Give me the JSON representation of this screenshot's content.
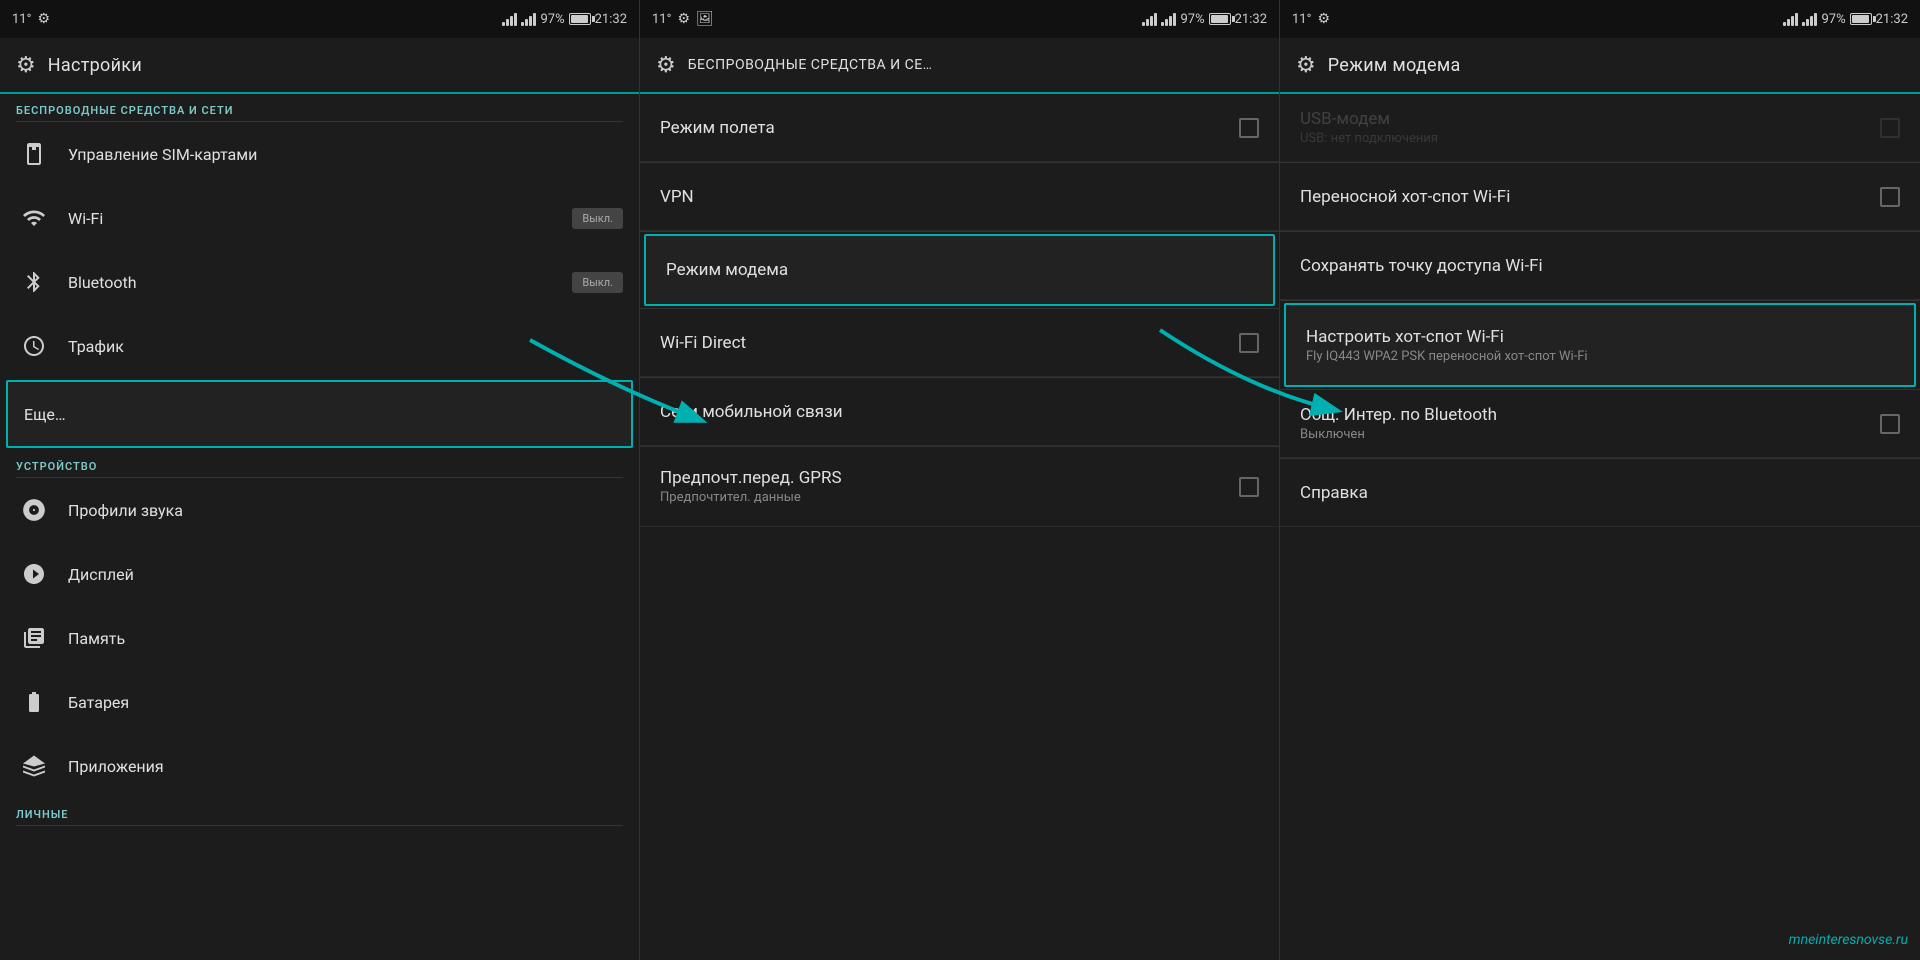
{
  "panel1": {
    "status": {
      "temp": "11°",
      "battery_pct": "97%",
      "time": "21:32"
    },
    "title": "Настройки",
    "section1": "БЕСПРОВОДНЫЕ СРЕДСТВА И СЕТИ",
    "items1": [
      {
        "icon": "sim",
        "label": "Управление SIM-картами",
        "toggle": null
      },
      {
        "icon": "wifi",
        "label": "Wi-Fi",
        "toggle": "Выкл."
      },
      {
        "icon": "bt",
        "label": "Bluetooth",
        "toggle": "Выкл."
      },
      {
        "icon": "traffic",
        "label": "Трафик",
        "toggle": null
      },
      {
        "icon": "more",
        "label": "Еще…",
        "toggle": null,
        "highlighted": true
      }
    ],
    "section2": "УСТРОЙСТВО",
    "items2": [
      {
        "icon": "sound",
        "label": "Профили звука"
      },
      {
        "icon": "display",
        "label": "Дисплей"
      },
      {
        "icon": "memory",
        "label": "Память"
      },
      {
        "icon": "battery",
        "label": "Батарея"
      },
      {
        "icon": "apps",
        "label": "Приложения"
      }
    ],
    "section3": "ЛИЧНЫЕ"
  },
  "panel2": {
    "status": {
      "temp": "11°",
      "battery_pct": "97%",
      "time": "21:32"
    },
    "title": "БЕСПРОВОДНЫЕ СРЕДСТВА И СЕ…",
    "items": [
      {
        "label": "Режим полета",
        "subtitle": null,
        "checkbox": true,
        "highlighted": false
      },
      {
        "label": "VPN",
        "subtitle": null,
        "checkbox": false,
        "highlighted": false
      },
      {
        "label": "Режим модема",
        "subtitle": null,
        "checkbox": false,
        "highlighted": true
      },
      {
        "label": "Wi-Fi Direct",
        "subtitle": null,
        "checkbox": true,
        "highlighted": false
      },
      {
        "label": "Сети мобильной связи",
        "subtitle": null,
        "checkbox": false,
        "highlighted": false
      },
      {
        "label": "Предпочт.перед. GPRS",
        "subtitle": "Предпочтител. данные",
        "checkbox": true,
        "highlighted": false
      }
    ]
  },
  "panel3": {
    "status": {
      "temp": "11°",
      "battery_pct": "97%",
      "time": "21:32"
    },
    "title": "Режим модема",
    "items": [
      {
        "label": "USB-модем",
        "subtitle": "USB: нет подключения",
        "checkbox": true,
        "disabled": true,
        "highlighted": false
      },
      {
        "label": "Переносной хот-спот Wi-Fi",
        "subtitle": null,
        "checkbox": true,
        "disabled": false,
        "highlighted": false
      },
      {
        "label": "Сохранять точку доступа Wi-Fi",
        "subtitle": null,
        "checkbox": false,
        "disabled": false,
        "highlighted": false
      },
      {
        "label": "Настроить хот-спот Wi-Fi",
        "subtitle": "Fly IQ443 WPA2 PSK переносной хот-спот Wi-Fi",
        "checkbox": false,
        "disabled": false,
        "highlighted": true
      },
      {
        "label": "Общ. Интер. по Bluetooth",
        "subtitle": "Выключен",
        "checkbox": true,
        "disabled": false,
        "highlighted": false
      },
      {
        "label": "Справка",
        "subtitle": null,
        "checkbox": false,
        "disabled": false,
        "highlighted": false
      }
    ],
    "watermark": "mneinteresnovse.ru"
  }
}
